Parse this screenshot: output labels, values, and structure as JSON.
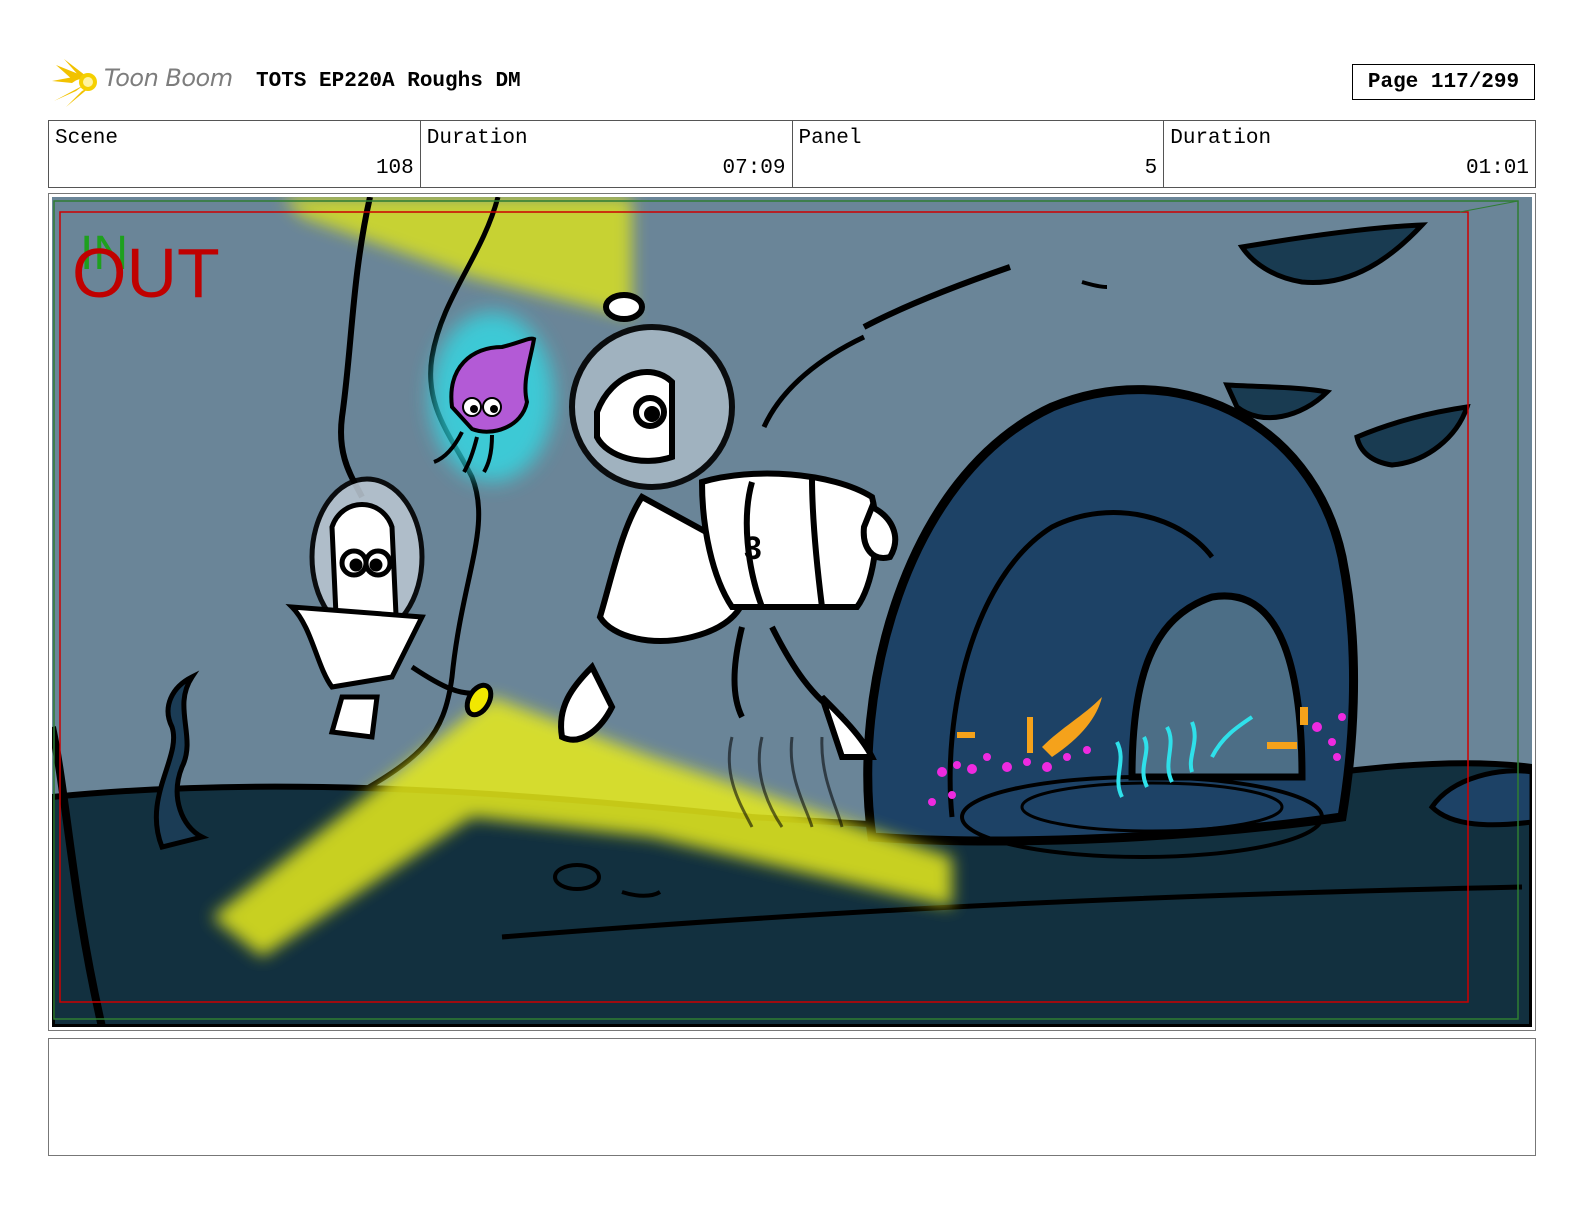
{
  "header": {
    "logo_text": "Toon Boom",
    "title": "TOTS EP220A Roughs DM",
    "page_label": "Page 117/299"
  },
  "info": {
    "scene_label": "Scene",
    "scene_value": "108",
    "scene_duration_label": "Duration",
    "scene_duration_value": "07:09",
    "panel_label": "Panel",
    "panel_value": "5",
    "panel_duration_label": "Duration",
    "panel_duration_value": "01:01"
  },
  "panel": {
    "in_marker": "IN",
    "out_marker": "OUT"
  },
  "colors": {
    "background": "#6a8598",
    "ground": "#12303f",
    "cave": "#1d4266",
    "light_beam": "#e8ec1a",
    "out_marker": "#c00000",
    "in_marker": "#1ea01e",
    "squid": "#b35ad6",
    "glow": "#2fe0ea",
    "coral_orange": "#f5a21b",
    "coral_magenta": "#ee2ae0"
  },
  "notes": {
    "text": ""
  }
}
